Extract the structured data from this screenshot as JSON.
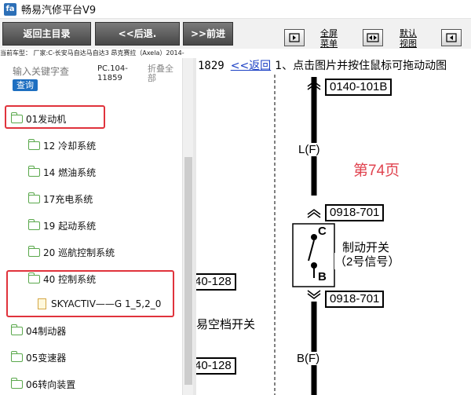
{
  "window": {
    "title": "畅易汽修平台V9",
    "icon_letter": "fa"
  },
  "toolbar": {
    "home": "返回主目录",
    "back": "<<后退.",
    "forward": ">>前进",
    "fullscreen_label": "全屏菜单",
    "default_view_label": "默认视图",
    "icons": [
      "fullscreen-icon",
      "default-view-icon",
      "next-page-icon"
    ]
  },
  "model_bar": "当前车型： 厂家:C-长安马自达马自达3 昂克赛拉（Axela）2014-",
  "search": {
    "placeholder": "输入关键字查",
    "button": "查询"
  },
  "pc_code": "PC.104-11859",
  "collapse_all": "折叠全部",
  "tree": [
    {
      "label": "01发动机",
      "type": "folder",
      "level": 0
    },
    {
      "label": "12 冷却系统",
      "type": "folder",
      "level": 1
    },
    {
      "label": "14 燃油系统",
      "type": "folder",
      "level": 1
    },
    {
      "label": "17充电系统",
      "type": "folder",
      "level": 1
    },
    {
      "label": "19 起动系统",
      "type": "folder",
      "level": 1
    },
    {
      "label": "20 巡航控制系统",
      "type": "folder",
      "level": 1
    },
    {
      "label": "40 控制系统",
      "type": "folder",
      "level": 1
    },
    {
      "label": "SKYACTIV——G 1_5,2_0",
      "type": "file",
      "level": 2
    },
    {
      "label": "04制动器",
      "type": "folder",
      "level": 0
    },
    {
      "label": "05变速器",
      "type": "folder",
      "level": 0
    },
    {
      "label": "06转向装置",
      "type": "folder",
      "level": 0
    }
  ],
  "diagram": {
    "page_number": "1829",
    "back_link": "<<返回",
    "hint": "1、点击图片并按住鼠标可拖动动图",
    "connectors": [
      "0140-101B",
      "0918-701",
      "0918-701"
    ],
    "left_connectors": [
      "40-128",
      "40-128"
    ],
    "wire_labels": [
      "L(F)",
      "B(F)"
    ],
    "page_label": "第74页",
    "switch_name": "制动开关",
    "switch_signal": "（2号信号）",
    "terminals": [
      "C",
      "B"
    ],
    "partial_text": "易空档开关",
    "page_label_color": "#e0434f"
  },
  "colors": {
    "highlight": "#e0333c",
    "folder": "#5aa84c",
    "button": "#1e6fc1"
  }
}
